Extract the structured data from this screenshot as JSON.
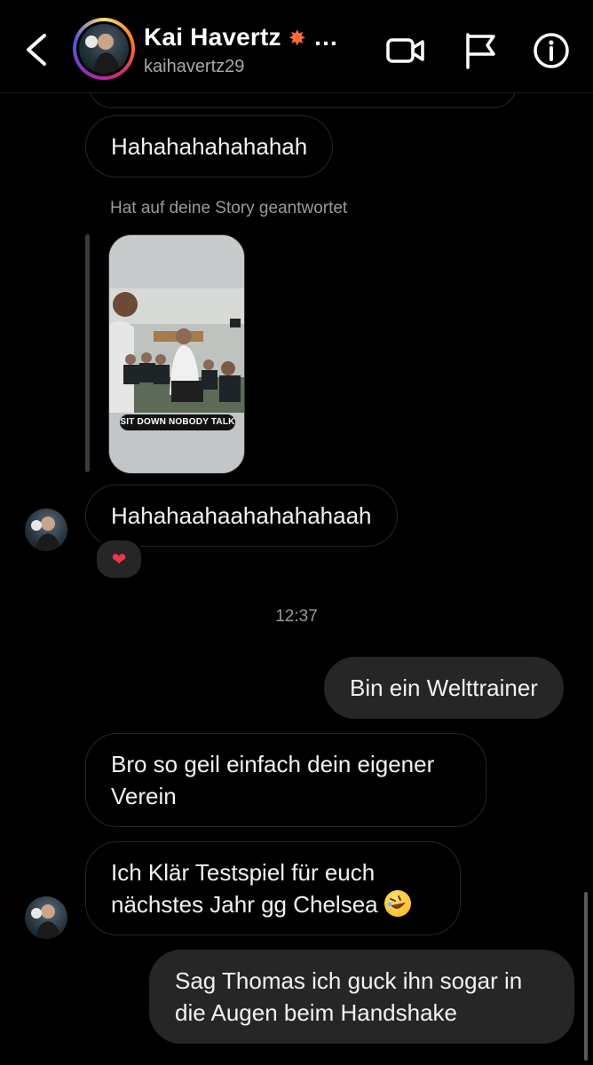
{
  "header": {
    "contact_name": "Kai Havertz",
    "name_suffix_icon": "collision-emoji",
    "name_ellipsis": "…",
    "handle": "kaihavertz29",
    "icons": [
      "back-chevron-icon",
      "video-call-icon",
      "flag-icon",
      "info-icon"
    ]
  },
  "messages": [
    {
      "from": "them",
      "text": "Hahahahahahahah"
    },
    {
      "from": "meta",
      "text": "Hat auf deine Story geantwortet"
    },
    {
      "from": "them",
      "type": "story",
      "caption": "SIT DOWN NOBODY TALK"
    },
    {
      "from": "them",
      "text": "Hahahaahaahahahahaah",
      "reaction": "heart"
    },
    {
      "from": "time",
      "text": "12:37"
    },
    {
      "from": "me",
      "text": "Bin ein Welttrainer"
    },
    {
      "from": "them",
      "lines": [
        "Bro so geil einfach dein eigener",
        "Verein"
      ]
    },
    {
      "from": "them",
      "lines": [
        "Ich Klär Testspiel für euch",
        "nächstes Jahr gg Chelsea"
      ],
      "emoji": "rolling-on-floor-laughing"
    },
    {
      "from": "me",
      "lines": [
        "Sag Thomas ich guck ihn sogar in",
        "die Augen beim Handshake"
      ]
    }
  ],
  "colors": {
    "background": "#000000",
    "bubble_border": "#262626",
    "my_bubble": "#262626",
    "secondary_text": "#a8a8a8",
    "heart": "#e8384f"
  }
}
